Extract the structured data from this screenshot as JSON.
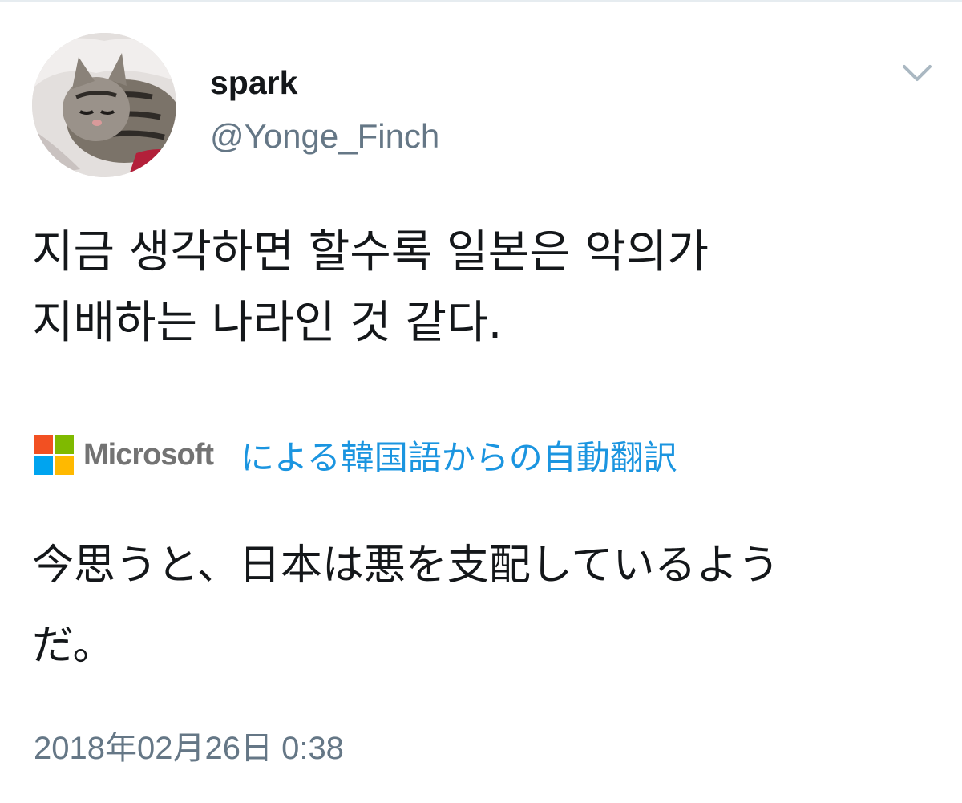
{
  "colors": {
    "text_primary": "#14171a",
    "text_secondary": "#657786",
    "link": "#1b95e0",
    "divider": "#e6ecf0",
    "ms_red": "#f25022",
    "ms_green": "#7fba00",
    "ms_blue": "#00a4ef",
    "ms_yellow": "#ffb900"
  },
  "author": {
    "display_name": "spark",
    "handle": "@Yonge_Finch",
    "avatar_icon": "cat-avatar-icon"
  },
  "menu": {
    "icon": "chevron-down-icon"
  },
  "tweet": {
    "text_line_1": "지금 생각하면 할수록 일본은 악의가",
    "text_line_2": "지배하는 나라인 것 같다."
  },
  "translation": {
    "provider_wordmark": "Microsoft",
    "provider_icon": "microsoft-logo-icon",
    "link_text": "による韓国語からの自動翻訳",
    "text_line_1": "今思うと、日本は悪を支配しているよう",
    "text_line_2": "だ。"
  },
  "timestamp": "2018年02月26日 0:38"
}
